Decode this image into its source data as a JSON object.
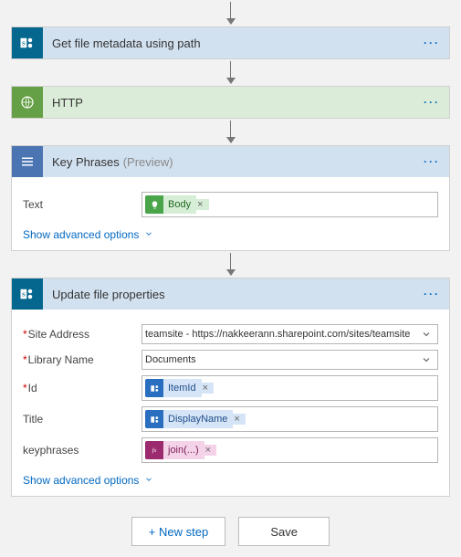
{
  "steps": {
    "getFile": {
      "title": "Get file metadata using path"
    },
    "http": {
      "title": "HTTP"
    },
    "keyPhrases": {
      "title": "Key Phrases",
      "preview": "(Preview)",
      "fields": {
        "text_label": "Text",
        "text_token": "Body"
      },
      "advanced": "Show advanced options"
    },
    "updateFile": {
      "title": "Update file properties",
      "fields": {
        "site_label": "Site Address",
        "site_value": "teamsite - https://nakkeerann.sharepoint.com/sites/teamsite",
        "library_label": "Library Name",
        "library_value": "Documents",
        "id_label": "Id",
        "id_token": "ItemId",
        "title_label": "Title",
        "title_token": "DisplayName",
        "keyphrases_label": "keyphrases",
        "keyphrases_token": "join(...)"
      },
      "advanced": "Show advanced options"
    }
  },
  "buttons": {
    "new_step": "+ New step",
    "save": "Save"
  },
  "ui": {
    "token_remove": "×",
    "menu": "···"
  }
}
